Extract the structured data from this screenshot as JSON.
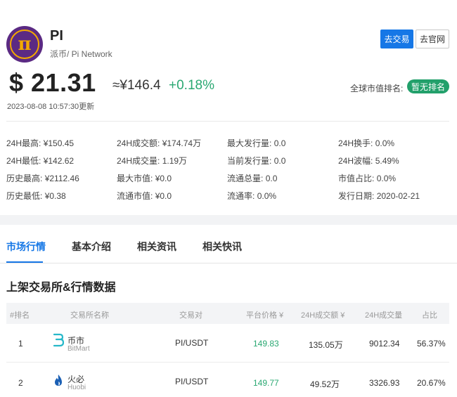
{
  "coin": {
    "symbol": "PI",
    "subtitle": "派币/ Pi Network",
    "logo_glyph": "π",
    "colors": {
      "logo_bg": "#5b2a83",
      "logo_ring": "#f2a900"
    }
  },
  "header_buttons": {
    "trade": "去交易",
    "website": "去官网"
  },
  "price": {
    "usd": "$ 21.31",
    "cny": "≈¥146.4",
    "change": "+0.18%",
    "updated": "2023-08-08 10:57:30更新"
  },
  "rank": {
    "label": "全球市值排名:",
    "value": "暂无排名"
  },
  "stats": [
    [
      "24H最高:",
      "¥150.45"
    ],
    [
      "24H成交额:",
      "¥174.74万"
    ],
    [
      "最大发行量:",
      "0.0"
    ],
    [
      "24H换手:",
      "0.0%"
    ],
    [
      "24H最低:",
      "¥142.62"
    ],
    [
      "24H成交量:",
      "1.19万"
    ],
    [
      "当前发行量:",
      "0.0"
    ],
    [
      "24H波幅:",
      "5.49%"
    ],
    [
      "历史最高:",
      "¥2112.46"
    ],
    [
      "最大市值:",
      "¥0.0"
    ],
    [
      "流通总量:",
      "0.0"
    ],
    [
      "市值占比:",
      "0.0%"
    ],
    [
      "历史最低:",
      "¥0.38"
    ],
    [
      "流通市值:",
      "¥0.0"
    ],
    [
      "流通率:",
      "0.0%"
    ],
    [
      "发行日期:",
      "2020-02-21"
    ]
  ],
  "tabs": [
    "市场行情",
    "基本介绍",
    "相关资讯",
    "相关快讯"
  ],
  "section_title": "上架交易所&行情数据",
  "table": {
    "headers": [
      "#排名",
      "交易所名称",
      "交易对",
      "平台价格 ¥",
      "24H成交额 ¥",
      "24H成交量",
      "占比"
    ],
    "rows": [
      {
        "rank": "1",
        "name_cn": "币市",
        "name_en": "BitMart",
        "pair": "PI/USDT",
        "price": "149.83",
        "amount": "135.05万",
        "volume": "9012.34",
        "share": "56.37%"
      },
      {
        "rank": "2",
        "name_cn": "火必",
        "name_en": "Huobi",
        "pair": "PI/USDT",
        "price": "149.77",
        "amount": "49.52万",
        "volume": "3326.93",
        "share": "20.67%"
      }
    ]
  },
  "accent_colors": {
    "blue": "#1677e6",
    "green": "#2aa872",
    "badge_green": "#22a06b"
  }
}
